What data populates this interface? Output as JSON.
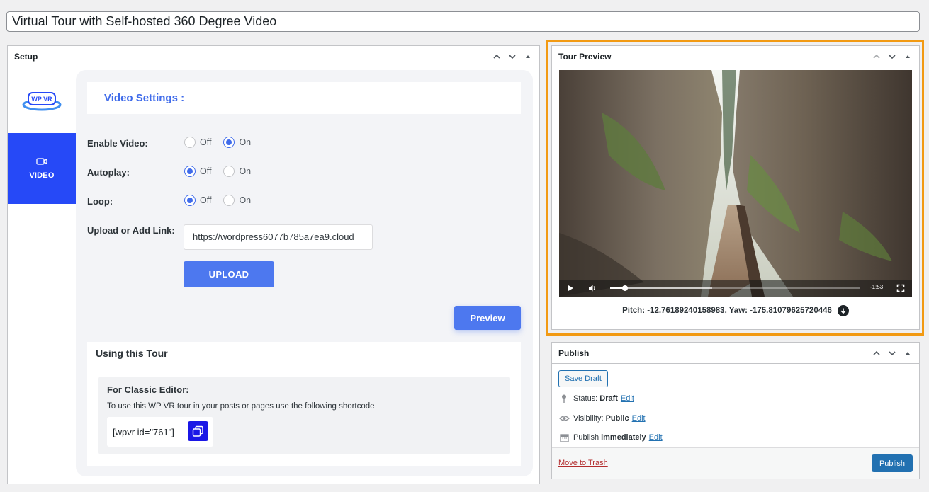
{
  "title": {
    "value": "Virtual Tour with Self-hosted 360 Degree Video"
  },
  "setup": {
    "box_title": "Setup",
    "logo_text": "WP VR",
    "video_tab_label": "VIDEO",
    "video_settings_title": "Video Settings :",
    "rows": {
      "enable_video": {
        "label": "Enable Video:",
        "off": "Off",
        "on": "On",
        "selected": "On"
      },
      "autoplay": {
        "label": "Autoplay:",
        "off": "Off",
        "on": "On",
        "selected": "Off"
      },
      "loop": {
        "label": "Loop:",
        "off": "Off",
        "on": "On",
        "selected": "Off"
      }
    },
    "upload_label": "Upload or Add Link:",
    "upload_value": "https://wordpress6077b785a7ea9.cloud",
    "upload_button": "UPLOAD",
    "preview_button": "Preview",
    "using": {
      "title": "Using this Tour",
      "classic_heading": "For Classic Editor:",
      "classic_text": "To use this WP VR tour in your posts or pages use the following shortcode",
      "shortcode": "[wpvr id=\"761\"]"
    }
  },
  "tour_preview": {
    "box_title": "Tour Preview",
    "time_remaining": "-1:53",
    "progress_fraction": 0.06,
    "buffered_fraction": 0.41,
    "pitch_yaw": "Pitch: -12.76189240158983, Yaw: -175.81079625720446"
  },
  "publish": {
    "box_title": "Publish",
    "save_draft": "Save Draft",
    "status_label": "Status:",
    "status_value": "Draft",
    "visibility_label": "Visibility:",
    "visibility_value": "Public",
    "publish_label": "Publish",
    "publish_value": "immediately",
    "edit": "Edit",
    "move_to_trash": "Move to Trash",
    "publish_button": "Publish"
  },
  "colors": {
    "accent": "#4d78ef",
    "video_tab": "#2649f7",
    "highlight": "#f29a13",
    "wp_blue": "#2271b1",
    "trash_red": "#b32d2e"
  },
  "icons": [
    "chevron-up-icon",
    "chevron-down-icon",
    "triangle-up-icon",
    "video-camera-icon",
    "copy-icon",
    "play-icon",
    "volume-icon",
    "fullscreen-icon",
    "download-arrow-icon",
    "pin-icon",
    "eye-icon",
    "calendar-icon"
  ]
}
